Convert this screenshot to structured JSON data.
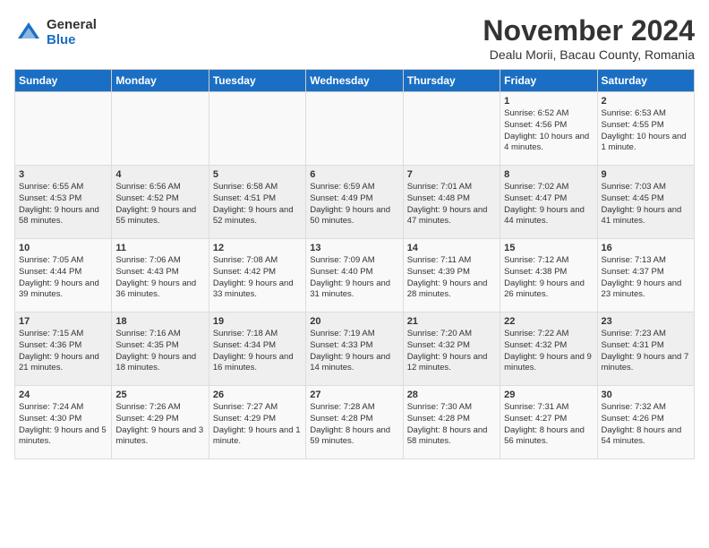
{
  "logo": {
    "general": "General",
    "blue": "Blue"
  },
  "title": "November 2024",
  "location": "Dealu Morii, Bacau County, Romania",
  "days_of_week": [
    "Sunday",
    "Monday",
    "Tuesday",
    "Wednesday",
    "Thursday",
    "Friday",
    "Saturday"
  ],
  "weeks": [
    [
      {
        "day": "",
        "info": ""
      },
      {
        "day": "",
        "info": ""
      },
      {
        "day": "",
        "info": ""
      },
      {
        "day": "",
        "info": ""
      },
      {
        "day": "",
        "info": ""
      },
      {
        "day": "1",
        "info": "Sunrise: 6:52 AM\nSunset: 4:56 PM\nDaylight: 10 hours and 4 minutes."
      },
      {
        "day": "2",
        "info": "Sunrise: 6:53 AM\nSunset: 4:55 PM\nDaylight: 10 hours and 1 minute."
      }
    ],
    [
      {
        "day": "3",
        "info": "Sunrise: 6:55 AM\nSunset: 4:53 PM\nDaylight: 9 hours and 58 minutes."
      },
      {
        "day": "4",
        "info": "Sunrise: 6:56 AM\nSunset: 4:52 PM\nDaylight: 9 hours and 55 minutes."
      },
      {
        "day": "5",
        "info": "Sunrise: 6:58 AM\nSunset: 4:51 PM\nDaylight: 9 hours and 52 minutes."
      },
      {
        "day": "6",
        "info": "Sunrise: 6:59 AM\nSunset: 4:49 PM\nDaylight: 9 hours and 50 minutes."
      },
      {
        "day": "7",
        "info": "Sunrise: 7:01 AM\nSunset: 4:48 PM\nDaylight: 9 hours and 47 minutes."
      },
      {
        "day": "8",
        "info": "Sunrise: 7:02 AM\nSunset: 4:47 PM\nDaylight: 9 hours and 44 minutes."
      },
      {
        "day": "9",
        "info": "Sunrise: 7:03 AM\nSunset: 4:45 PM\nDaylight: 9 hours and 41 minutes."
      }
    ],
    [
      {
        "day": "10",
        "info": "Sunrise: 7:05 AM\nSunset: 4:44 PM\nDaylight: 9 hours and 39 minutes."
      },
      {
        "day": "11",
        "info": "Sunrise: 7:06 AM\nSunset: 4:43 PM\nDaylight: 9 hours and 36 minutes."
      },
      {
        "day": "12",
        "info": "Sunrise: 7:08 AM\nSunset: 4:42 PM\nDaylight: 9 hours and 33 minutes."
      },
      {
        "day": "13",
        "info": "Sunrise: 7:09 AM\nSunset: 4:40 PM\nDaylight: 9 hours and 31 minutes."
      },
      {
        "day": "14",
        "info": "Sunrise: 7:11 AM\nSunset: 4:39 PM\nDaylight: 9 hours and 28 minutes."
      },
      {
        "day": "15",
        "info": "Sunrise: 7:12 AM\nSunset: 4:38 PM\nDaylight: 9 hours and 26 minutes."
      },
      {
        "day": "16",
        "info": "Sunrise: 7:13 AM\nSunset: 4:37 PM\nDaylight: 9 hours and 23 minutes."
      }
    ],
    [
      {
        "day": "17",
        "info": "Sunrise: 7:15 AM\nSunset: 4:36 PM\nDaylight: 9 hours and 21 minutes."
      },
      {
        "day": "18",
        "info": "Sunrise: 7:16 AM\nSunset: 4:35 PM\nDaylight: 9 hours and 18 minutes."
      },
      {
        "day": "19",
        "info": "Sunrise: 7:18 AM\nSunset: 4:34 PM\nDaylight: 9 hours and 16 minutes."
      },
      {
        "day": "20",
        "info": "Sunrise: 7:19 AM\nSunset: 4:33 PM\nDaylight: 9 hours and 14 minutes."
      },
      {
        "day": "21",
        "info": "Sunrise: 7:20 AM\nSunset: 4:32 PM\nDaylight: 9 hours and 12 minutes."
      },
      {
        "day": "22",
        "info": "Sunrise: 7:22 AM\nSunset: 4:32 PM\nDaylight: 9 hours and 9 minutes."
      },
      {
        "day": "23",
        "info": "Sunrise: 7:23 AM\nSunset: 4:31 PM\nDaylight: 9 hours and 7 minutes."
      }
    ],
    [
      {
        "day": "24",
        "info": "Sunrise: 7:24 AM\nSunset: 4:30 PM\nDaylight: 9 hours and 5 minutes."
      },
      {
        "day": "25",
        "info": "Sunrise: 7:26 AM\nSunset: 4:29 PM\nDaylight: 9 hours and 3 minutes."
      },
      {
        "day": "26",
        "info": "Sunrise: 7:27 AM\nSunset: 4:29 PM\nDaylight: 9 hours and 1 minute."
      },
      {
        "day": "27",
        "info": "Sunrise: 7:28 AM\nSunset: 4:28 PM\nDaylight: 8 hours and 59 minutes."
      },
      {
        "day": "28",
        "info": "Sunrise: 7:30 AM\nSunset: 4:28 PM\nDaylight: 8 hours and 58 minutes."
      },
      {
        "day": "29",
        "info": "Sunrise: 7:31 AM\nSunset: 4:27 PM\nDaylight: 8 hours and 56 minutes."
      },
      {
        "day": "30",
        "info": "Sunrise: 7:32 AM\nSunset: 4:26 PM\nDaylight: 8 hours and 54 minutes."
      }
    ]
  ]
}
